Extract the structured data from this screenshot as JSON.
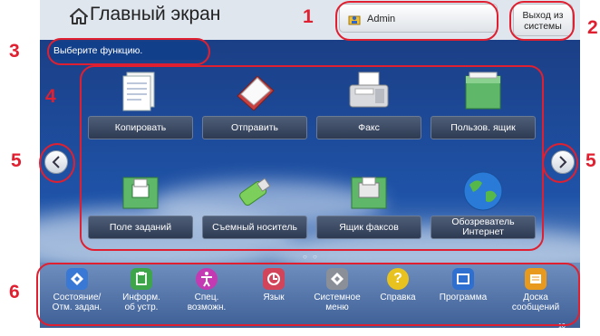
{
  "header": {
    "title": "Главный экран",
    "user": "Admin",
    "logout_label": "Выход из системы"
  },
  "message": "Выберите функцию.",
  "tiles": [
    {
      "label": "Копировать",
      "icon": "copy-icon"
    },
    {
      "label": "Отправить",
      "icon": "send-icon"
    },
    {
      "label": "Факс",
      "icon": "fax-icon"
    },
    {
      "label": "Пользов. ящик",
      "icon": "user-box-icon"
    },
    {
      "label": "Поле заданий",
      "icon": "job-box-icon"
    },
    {
      "label": "Съемный носитель",
      "icon": "usb-drive-icon"
    },
    {
      "label": "Ящик факсов",
      "icon": "fax-box-icon"
    },
    {
      "label": "Обозреватель Интернет",
      "icon": "globe-icon"
    }
  ],
  "bottom": [
    {
      "label": "Состояние/\nОтм. задан.",
      "icon": "status-icon",
      "color": "#3a78d6"
    },
    {
      "label": "Информ.\nоб устр.",
      "icon": "device-info-icon",
      "color": "#3ea54a"
    },
    {
      "label": "Спец.\nвозможн.",
      "icon": "accessibility-icon",
      "color": "#c43ab2"
    },
    {
      "label": "Язык",
      "icon": "language-icon",
      "color": "#d2445a"
    },
    {
      "label": "Системное\nменю",
      "icon": "system-menu-icon",
      "color": "#8a8f98"
    },
    {
      "label": "Справка",
      "icon": "help-icon",
      "color": "#e8c21e"
    },
    {
      "label": "Программа",
      "icon": "program-icon",
      "color": "#2f6fd0"
    },
    {
      "label": "Доска\nсообщений",
      "icon": "message-board-icon",
      "color": "#e89a1e"
    }
  ],
  "annotations": [
    "1",
    "2",
    "3",
    "4",
    "5",
    "5",
    "6"
  ],
  "page_indicator": "○ ○",
  "status_time": "10"
}
